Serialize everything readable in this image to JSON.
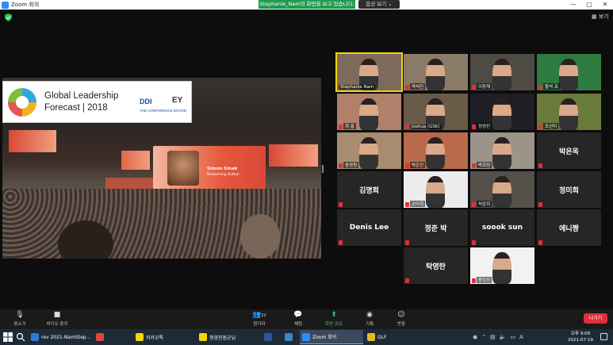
{
  "window": {
    "title": "Zoom 회의"
  },
  "share_banner": {
    "text": "Stephanie_Nam의 화면을 보고 있습니다.",
    "options_label": "옵션 보기 ⌄"
  },
  "view": {
    "label": "보기"
  },
  "presentation": {
    "title_line1": "Global Leadership",
    "title_line2": "Forecast | 2018",
    "ddi": "DDI",
    "ey": "EY",
    "conference_board": "THE CONFERENCE BOARD",
    "speaker_name": "Simon Sinek",
    "speaker_role": "Bestselling Author"
  },
  "participants": [
    {
      "name": "Stephanie Nam",
      "type": "video",
      "active": true
    },
    {
      "name": "곽석진",
      "type": "video"
    },
    {
      "name": "이창재",
      "type": "video"
    },
    {
      "name": "황석 조",
      "type": "video"
    },
    {
      "name": "최 흥",
      "type": "video"
    },
    {
      "name": "Joshua (GSK)",
      "type": "video"
    },
    {
      "name": "정영진",
      "type": "video"
    },
    {
      "name": "조선미",
      "type": "video"
    },
    {
      "name": "윤경원",
      "type": "video"
    },
    {
      "name": "박은진",
      "type": "video"
    },
    {
      "name": "박희정",
      "type": "video"
    },
    {
      "name": "박은옥",
      "type": "name"
    },
    {
      "name": "김명희",
      "type": "name"
    },
    {
      "name": "손미희",
      "type": "video"
    },
    {
      "name": "석승희",
      "type": "video"
    },
    {
      "name": "정미희",
      "type": "name"
    },
    {
      "name": "Denis Lee",
      "type": "name"
    },
    {
      "name": "정준 박",
      "type": "name"
    },
    {
      "name": "soook sun",
      "type": "name"
    },
    {
      "name": "에니짱",
      "type": "name"
    },
    {
      "name": "탁영란",
      "type": "name"
    },
    {
      "name": "용희정",
      "type": "video"
    }
  ],
  "toolbar": {
    "mute": "음소거",
    "stop_video": "비디오 중지",
    "participants": "참가자",
    "participants_count": "22",
    "chat": "채팅",
    "share": "화면 공유",
    "record": "기록",
    "reactions": "반응",
    "leave": "나가기"
  },
  "taskbar": {
    "apps": [
      {
        "label": "rev 2021-NamStep...",
        "color": "#2b7cd3"
      },
      {
        "label": "",
        "color": "#dd4b39"
      },
      {
        "label": "카카오톡",
        "color": "#f7d700"
      },
      {
        "label": "청영진점군님",
        "color": "#f7d700"
      },
      {
        "label": "",
        "color": "#2b5797"
      },
      {
        "label": "",
        "color": "#3a87c9"
      },
      {
        "label": "Zoom 회의",
        "color": "#2d8cff"
      },
      {
        "label": "GLF",
        "color": "#e8b923"
      }
    ],
    "tray_lang": "A",
    "time": "오후 9:09",
    "date": "2021-07-19"
  }
}
